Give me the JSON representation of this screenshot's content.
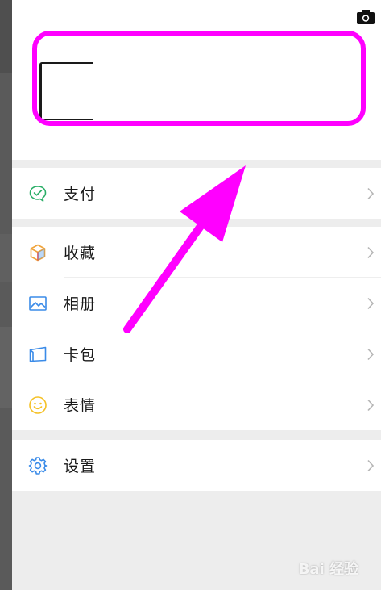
{
  "menu": {
    "pay": {
      "label": "支付",
      "icon": "wallet-icon"
    },
    "favorites": {
      "label": "收藏",
      "icon": "cube-icon"
    },
    "album": {
      "label": "相册",
      "icon": "photo-icon"
    },
    "cards": {
      "label": "卡包",
      "icon": "card-icon"
    },
    "stickers": {
      "label": "表情",
      "icon": "smiley-icon"
    },
    "settings": {
      "label": "设置",
      "icon": "gear-icon"
    }
  },
  "watermark": {
    "text": "Bai 经验"
  },
  "colors": {
    "highlight": "#ff00ff",
    "pay_green": "#2aae67",
    "favorites_orange": "#f0a33a",
    "album_blue": "#3a8be8",
    "cards_blue": "#3a8be8",
    "stickers_yellow": "#f5c125",
    "settings_blue": "#3a8be8"
  }
}
